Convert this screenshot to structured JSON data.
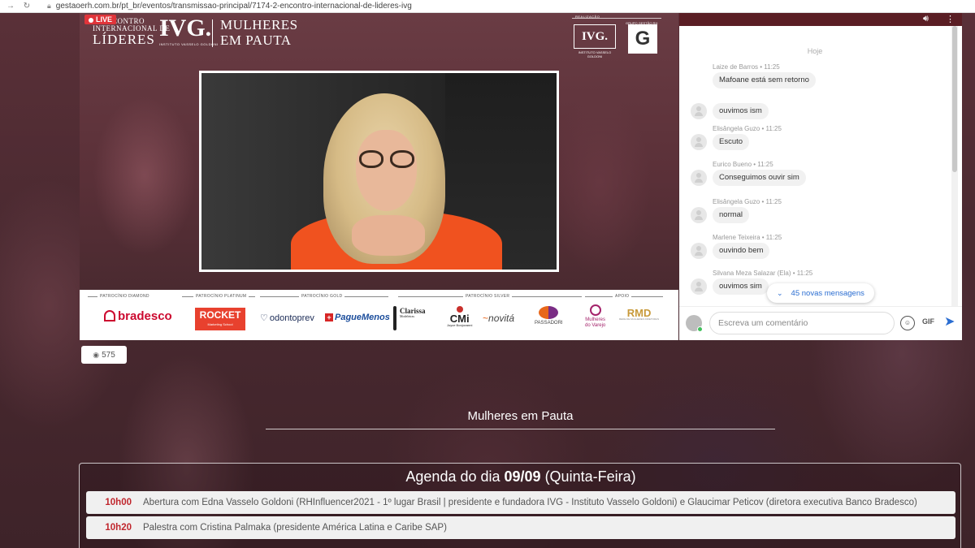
{
  "browser": {
    "url": "gestaoerh.com.br/pt_br/eventos/transmissao-principal/7174-2-encontro-internacional-de-lideres-ivg"
  },
  "video": {
    "live_label": "LIVE",
    "brand_small_1": "2º ENCONTRO",
    "brand_small_2": "INTERNACIONAL DE",
    "brand_big": "LÍDERES",
    "ivg_logo": "IVG.",
    "ivg_sub": "INSTITUTO VASSELO GOLDONI",
    "mp_line1": "MULHERES",
    "mp_line2": "EM PAUTA",
    "realizacao_label": "REALIZAÇÃO",
    "logo_ivg_box": "IVG.",
    "logo_ivg_box_sub": "INSTITUTO VASSELO GOLDONI",
    "logo_g_label": "GRUPO GESTÃO RH",
    "logo_g": "G"
  },
  "sponsors": {
    "categories": {
      "diamond": "PATROCÍNIO DIAMOND",
      "platinum": "PATROCÍNIO PLATINUM",
      "gold": "PATROCÍNIO GOLD",
      "silver": "PATROCÍNIO SILVER",
      "apoio": "APOIO"
    },
    "bradesco": "bradesco",
    "rocket": "ROCKET",
    "rocket_sub": "Marketing School",
    "odontoprev": "odontoprev",
    "paguemenos": "PagueMenos",
    "clarissa": "Clarissa",
    "clarissa_sub": "Modeleiras",
    "cmi": "CMi",
    "cmi_sub": "Joyce Bonjovanni",
    "novita": "novitá",
    "passadori": "PASSADORI",
    "mulheres_varejo_1": "Mulheres",
    "mulheres_varejo_2": "do Varejo",
    "rmd": "RMD",
    "rmd_sub": "REDE DE MULHERES DIRETORAS"
  },
  "viewers": {
    "count": "575"
  },
  "chat": {
    "day_label": "Hoje",
    "messages": [
      {
        "author": "Laize de Barros",
        "time": "11:25",
        "text": "Mafoane está sem retorno",
        "show_author": true,
        "avatar": false
      },
      {
        "author": "",
        "time": "",
        "text": "ouvimos ism",
        "show_author": false,
        "avatar": true
      },
      {
        "author": "Elisângela Guzo",
        "time": "11:25",
        "text": "Escuto",
        "show_author": true,
        "avatar": true
      },
      {
        "author": "Eurico Bueno",
        "time": "11:25",
        "text": "Conseguimos ouvir sim",
        "show_author": true,
        "avatar": true
      },
      {
        "author": "Elisângela Guzo",
        "time": "11:25",
        "text": "normal",
        "show_author": true,
        "avatar": true
      },
      {
        "author": "Marlene Teixeira",
        "time": "11:25",
        "text": "ouvindo bem",
        "show_author": true,
        "avatar": true
      },
      {
        "author": "Silvana Meza Salazar (Ela)",
        "time": "11:25",
        "text": "ouvimos sim",
        "show_author": true,
        "avatar": true
      }
    ],
    "new_messages": "45 novas mensagens",
    "input_placeholder": "Escreva um comentário",
    "gif_label": "GIF",
    "emoji_icon": "emoji-icon",
    "send_icon": "send-icon",
    "volume_icon": "volume-icon",
    "menu_icon": "more-vertical-icon"
  },
  "section": {
    "title": "Mulheres em Pauta"
  },
  "agenda": {
    "title_prefix": "Agenda do dia ",
    "title_date": "09/09",
    "title_suffix": " (Quinta-Feira)",
    "items": [
      {
        "time": "10h00",
        "desc": "Abertura com Edna Vasselo Goldoni (RHInfluencer2021 - 1º lugar Brasil | presidente e fundadora IVG - Instituto Vasselo Goldoni) e Glaucimar Peticov (diretora executiva Banco Bradesco)"
      },
      {
        "time": "10h20",
        "desc": "Palestra com Cristina Palmaka (presidente América Latina e Caribe SAP)"
      }
    ]
  }
}
